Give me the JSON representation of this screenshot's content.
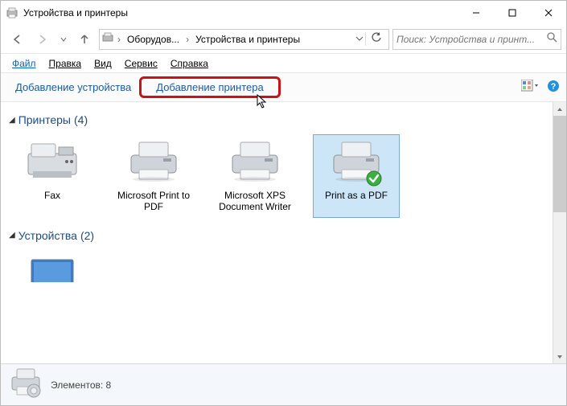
{
  "window": {
    "title": "Устройства и принтеры",
    "controls": {
      "min": "–",
      "max": "☐",
      "close": "✕"
    }
  },
  "nav": {
    "crumb1": "Оборудов...",
    "crumb2": "Устройства и принтеры",
    "search_placeholder": "Поиск: Устройства и принт..."
  },
  "menu": {
    "file": "Файл",
    "edit": "Правка",
    "view": "Вид",
    "service": "Сервис",
    "help": "Справка"
  },
  "toolbar": {
    "add_device": "Добавление устройства",
    "add_printer": "Добавление принтера"
  },
  "groups": {
    "printers": {
      "title": "Принтеры",
      "count": "(4)"
    },
    "devices": {
      "title": "Устройства",
      "count": "(2)"
    }
  },
  "printers": [
    {
      "label": "Fax"
    },
    {
      "label": "Microsoft Print to PDF"
    },
    {
      "label": "Microsoft XPS Document Writer"
    },
    {
      "label": "Print as a PDF",
      "selected": true,
      "default": true
    }
  ],
  "status": {
    "items_label": "Элементов: 8"
  }
}
